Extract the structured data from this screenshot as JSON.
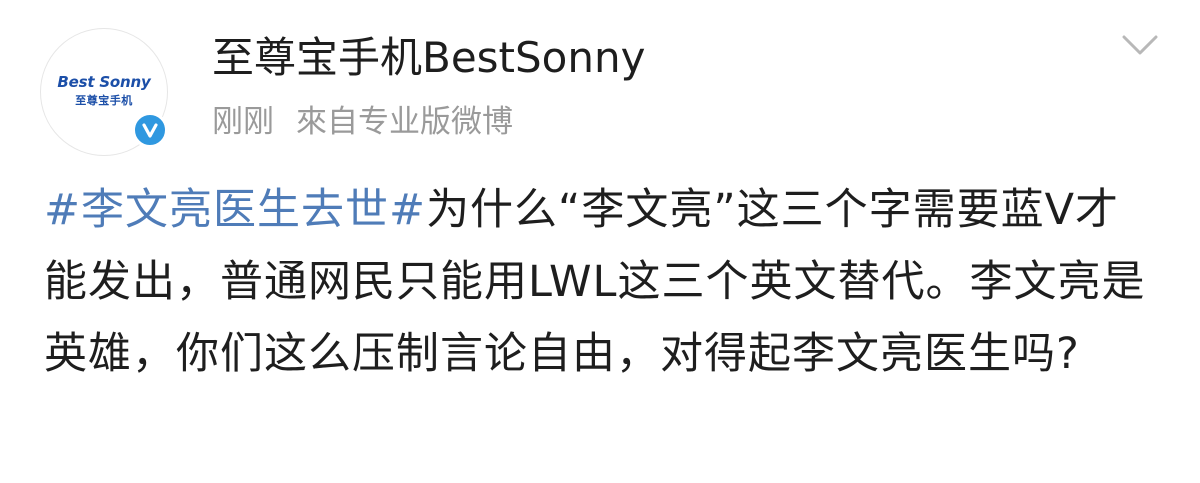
{
  "post": {
    "author": {
      "name": "至尊宝手机BestSonny",
      "avatar_logo_en": "Best Sonny",
      "avatar_logo_cn": "至尊宝手机"
    },
    "meta": {
      "time": "刚刚",
      "source": "來自专业版微博"
    },
    "content": {
      "hashtag": "#李文亮医生去世#",
      "text": "为什么“李文亮”这三个字需要蓝Ⅴ才能发出，普通网民只能用LWL这三个英文替代。李文亮是英雄，你们这么压制言论自由，对得起李文亮医生吗?"
    },
    "icons": {
      "verified": "verified-badge-icon",
      "menu": "chevron-down-icon"
    },
    "colors": {
      "hashtag": "#4f7cb8",
      "verified": "#2f98e0",
      "meta": "#9a9a9a",
      "brand": "#1c4fa8"
    }
  }
}
